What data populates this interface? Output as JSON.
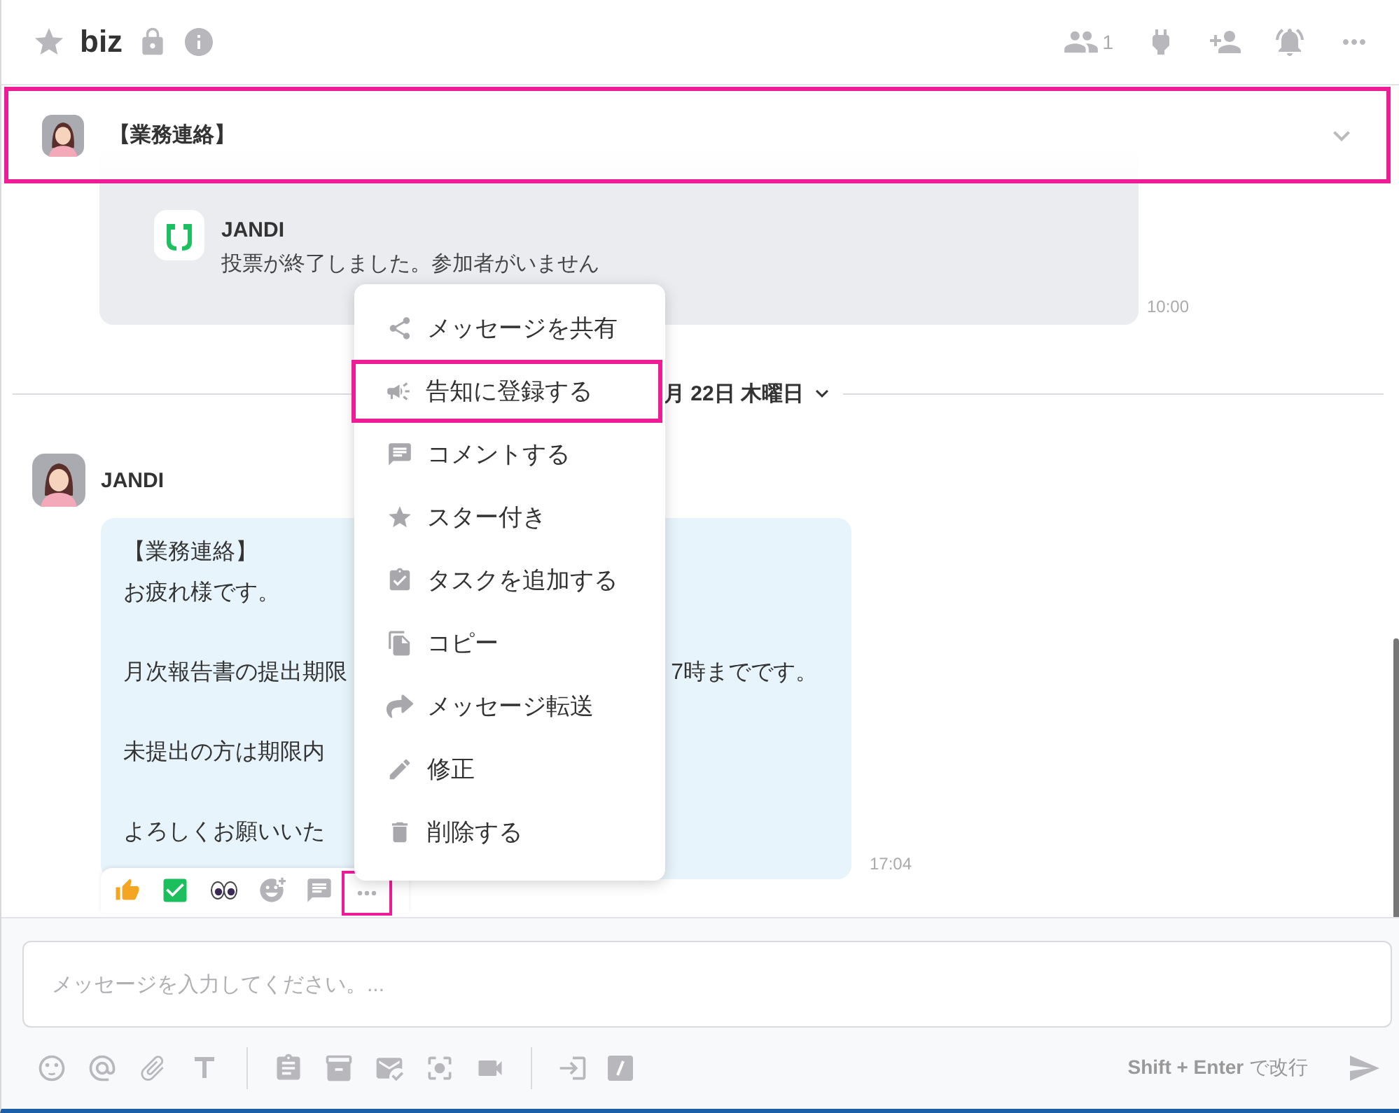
{
  "header": {
    "title": "biz",
    "starred": false,
    "member_count": "1"
  },
  "pinned_announcement": {
    "text": "【業務連絡】",
    "highlighted": true
  },
  "system_message": {
    "sender": "JANDI",
    "text": "投票が終了しました。参加者がいません",
    "time": "10:00"
  },
  "date_divider": "月 22日 木曜日",
  "message": {
    "sender": "JANDI",
    "time": "17:04",
    "paragraphs": [
      [
        {
          "text": "【業務連絡】"
        },
        {
          "text": "お疲れ様です。"
        }
      ],
      [
        {
          "text": "月次報告書の提出期限",
          "text_after": "7時までです。"
        }
      ],
      [
        {
          "text": "未提出の方は期限内"
        }
      ],
      [
        {
          "text": "よろしくお願いいた"
        }
      ]
    ]
  },
  "reaction_bar": {
    "more_highlighted": true
  },
  "context_menu": [
    {
      "label": "メッセージを共有",
      "highlighted": false
    },
    {
      "label": "告知に登録する",
      "highlighted": true
    },
    {
      "label": "コメントする",
      "highlighted": false
    },
    {
      "label": "スター付き",
      "highlighted": false
    },
    {
      "label": "タスクを追加する",
      "highlighted": false
    },
    {
      "label": "コピー",
      "highlighted": false
    },
    {
      "label": "メッセージ転送",
      "highlighted": false
    },
    {
      "label": "修正",
      "highlighted": false
    },
    {
      "label": "削除する",
      "highlighted": false
    }
  ],
  "composer": {
    "placeholder": "メッセージを入力してください。...",
    "hint": "**Shift + Enter** で改行"
  }
}
